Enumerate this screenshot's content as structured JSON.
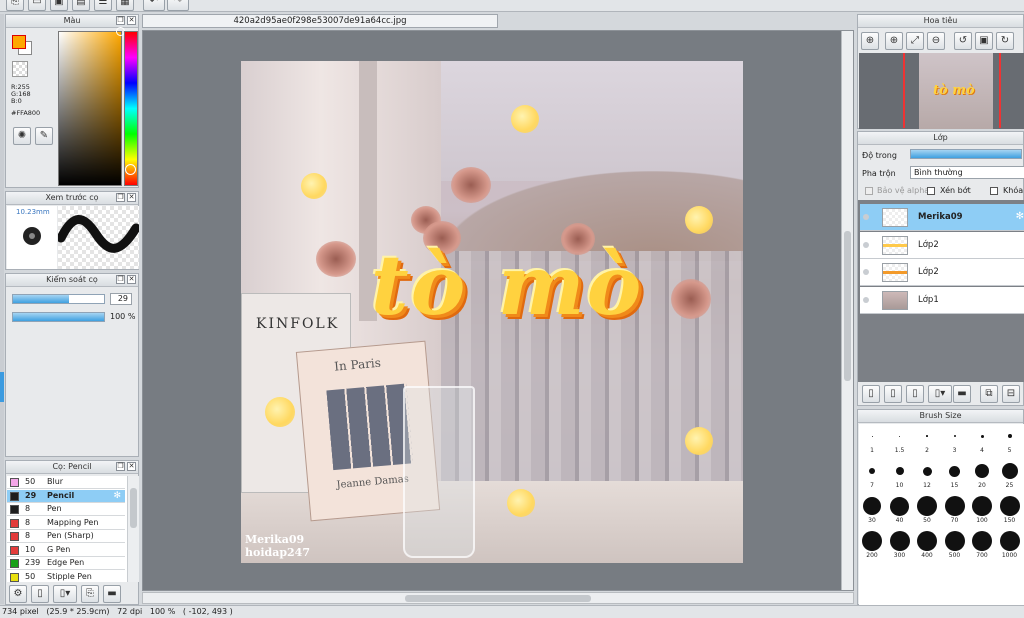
{
  "document": {
    "filename": "420a2d95ae0f298e53007de91a64cc.jpg"
  },
  "color_panel": {
    "title": "Màu",
    "r": "R:255",
    "g": "G:168",
    "b": "B:0",
    "hex": "#FFA800",
    "primary_color": "#ffa800"
  },
  "brush_preview": {
    "title": "Xem trước cọ",
    "size": "10.23mm"
  },
  "brush_control": {
    "title": "Kiểm soát cọ",
    "size_value": "29",
    "opacity_value": "100 %",
    "size_fraction": 0.62,
    "opacity_fraction": 1.0
  },
  "brush_list": {
    "title": "Cọ: Pencil",
    "items": [
      {
        "size": "50",
        "name": "Blur",
        "color": "#f4a6e8"
      },
      {
        "size": "29",
        "name": "Pencil",
        "color": "#1e1e1e",
        "selected": true
      },
      {
        "size": "8",
        "name": "Pen",
        "color": "#1e1e1e"
      },
      {
        "size": "8",
        "name": "Mapping Pen",
        "color": "#e33b3b"
      },
      {
        "size": "8",
        "name": "Pen (Sharp)",
        "color": "#e33b3b"
      },
      {
        "size": "10",
        "name": "G Pen",
        "color": "#e33b3b"
      },
      {
        "size": "239",
        "name": "Edge Pen",
        "color": "#18a018"
      },
      {
        "size": "50",
        "name": "Stipple Pen",
        "color": "#e8e010"
      }
    ]
  },
  "navigator": {
    "title": "Hoa tiêu"
  },
  "layers": {
    "title": "Lớp",
    "opacity_label": "Độ trong",
    "blend_label": "Pha trộn",
    "blend_value": "Bình thường",
    "protect_alpha": "Bảo vệ alpha",
    "clipping": "Xén bớt",
    "lock": "Khóa",
    "items": [
      {
        "name": "Merika09",
        "selected": true
      },
      {
        "name": "Lớp2"
      },
      {
        "name": "Lớp2"
      },
      {
        "name": "Lớp1"
      }
    ]
  },
  "brush_size": {
    "title": "Brush Size",
    "sizes": [
      "1",
      "1.5",
      "2",
      "3",
      "4",
      "5",
      "7",
      "10",
      "12",
      "15",
      "20",
      "25",
      "30",
      "40",
      "50",
      "70",
      "100",
      "150",
      "200",
      "300",
      "400",
      "500",
      "700",
      "1000"
    ]
  },
  "artwork": {
    "title_text": "tò mò",
    "watermark_line1": "Merika09",
    "watermark_line2": "hoidap247",
    "book_title1": "In Paris",
    "book_title2": "Jeanne Damas",
    "book_spine": "KINFOLK"
  },
  "status_bar": {
    "text": "734 pixel   (25.9 * 25.9cm)   72 dpi   100 %   ( -102, 493 )"
  }
}
